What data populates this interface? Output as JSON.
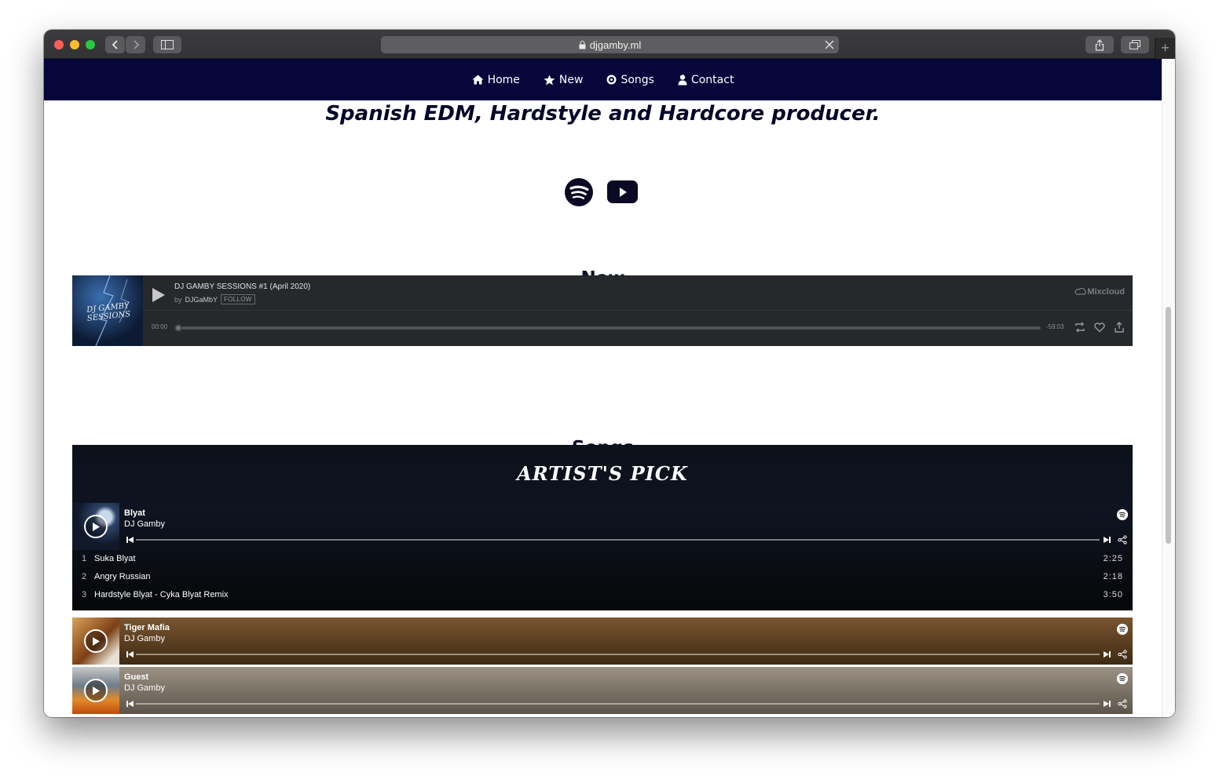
{
  "browser": {
    "url": "djgamby.ml",
    "new_tab_symbol": "+"
  },
  "nav": {
    "items": [
      {
        "label": "Home",
        "icon": "home-icon"
      },
      {
        "label": "New",
        "icon": "star-icon"
      },
      {
        "label": "Songs",
        "icon": "disc-icon"
      },
      {
        "label": "Contact",
        "icon": "user-icon"
      }
    ]
  },
  "hero": {
    "tagline": "Spanish EDM, Hardstyle and Hardcore producer."
  },
  "sections": {
    "new_title": "New",
    "songs_title": "Songs"
  },
  "mixcloud": {
    "art_text_line1": "DJ GAMBY",
    "art_text_line2": "SESSIONS",
    "title": "DJ GAMBY SESSIONS #1 (April 2020)",
    "by_prefix": "by",
    "artist": "DJGaMbY",
    "follow_label": "FOLLOW",
    "logo": "Mixcloud",
    "time_elapsed": "00:00",
    "time_remaining": "-59:03"
  },
  "spotify": {
    "pick_title": "ARTIST'S PICK",
    "featured": {
      "name": "Blyat",
      "artist": "DJ Gamby",
      "tracks": [
        {
          "num": "1",
          "name": "Suka Blyat",
          "duration": "2:25"
        },
        {
          "num": "2",
          "name": "Angry Russian",
          "duration": "2:18"
        },
        {
          "num": "3",
          "name": "Hardstyle Blyat - Cyka Blyat Remix",
          "duration": "3:50"
        }
      ]
    },
    "embeds": [
      {
        "name": "Tiger Mafia",
        "artist": "DJ Gamby",
        "bg": "#6b4a25"
      },
      {
        "name": "Guest",
        "artist": "DJ Gamby",
        "bg": "#8a8075"
      }
    ]
  },
  "colors": {
    "navbar": "#06063a",
    "heading": "#0a0a25",
    "mixcloud_bg": "#26282b"
  }
}
